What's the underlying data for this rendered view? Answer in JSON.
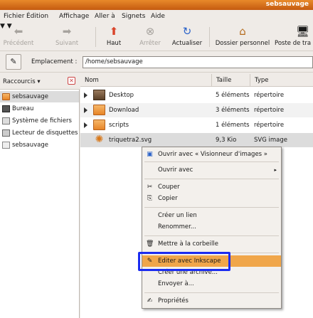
{
  "window": {
    "title": "sebsauvage"
  },
  "menubar": [
    "Fichier",
    "Édition",
    "Affichage",
    "Aller à",
    "Signets",
    "Aide"
  ],
  "toolbar": {
    "back": "Précédent",
    "forward": "Suivant",
    "up": "Haut",
    "stop": "Arrêter",
    "reload": "Actualiser",
    "home": "Dossier personnel",
    "computer": "Poste de tra"
  },
  "location": {
    "label": "Emplacement :",
    "value": "/home/sebsauvage"
  },
  "sidebar": {
    "title": "Raccourcis",
    "items": [
      "sebsauvage",
      "Bureau",
      "Système de fichiers",
      "Lecteur de disquettes",
      "sebsauvage"
    ]
  },
  "columns": {
    "name": "Nom",
    "size": "Taille",
    "type": "Type"
  },
  "files": [
    {
      "name": "Desktop",
      "size": "5 éléments",
      "type": "répertoire"
    },
    {
      "name": "Download",
      "size": "3 éléments",
      "type": "répertoire"
    },
    {
      "name": "scripts",
      "size": "1 éléments",
      "type": "répertoire"
    },
    {
      "name": "triquetra2.svg",
      "size": "9,3 Kio",
      "type": "SVG image"
    }
  ],
  "context_menu": [
    "Ouvrir avec « Visionneur d'images »",
    "Ouvrir avec",
    "Couper",
    "Copier",
    "Créer un lien",
    "Renommer...",
    "Mettre à la corbeille",
    "Editer avec Inkscape",
    "Créer une archive...",
    "Envoyer à...",
    "Propriétés"
  ],
  "colors": {
    "highlight": "#f0a64a",
    "annotation_box": "#1b2cf0",
    "titlebar": "#d8701a"
  }
}
